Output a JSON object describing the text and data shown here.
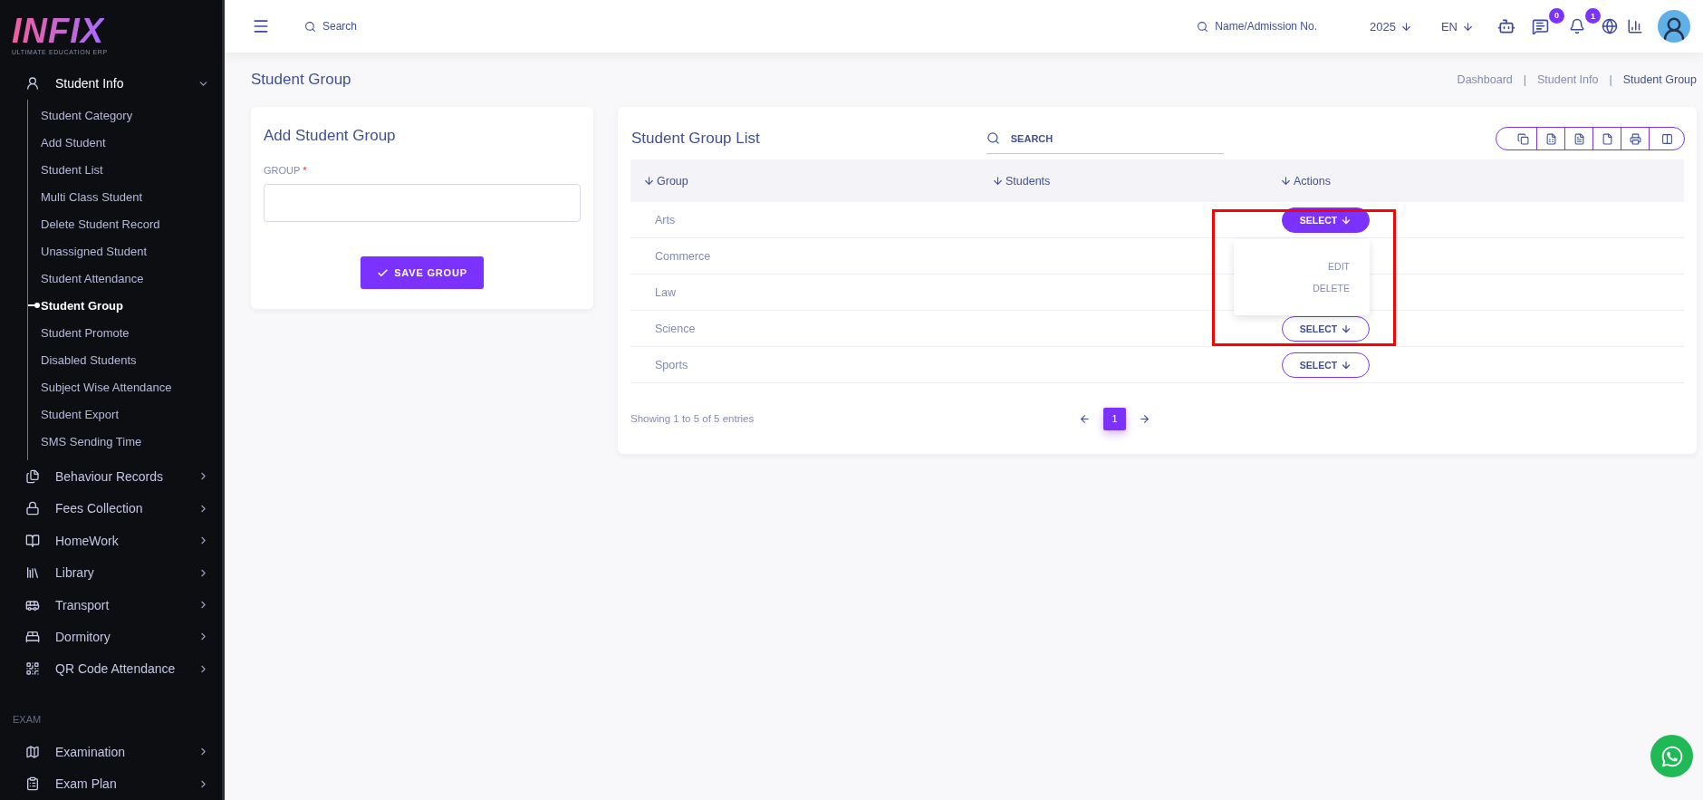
{
  "logo": {
    "name": "INFIX",
    "tagline": "ULTIMATE EDUCATION ERP"
  },
  "sidebar": {
    "sections": [
      {
        "label": "Student Info",
        "expanded": true,
        "children": [
          {
            "label": "Student Category",
            "selected": false
          },
          {
            "label": "Add Student",
            "selected": false
          },
          {
            "label": "Student List",
            "selected": false
          },
          {
            "label": "Multi Class Student",
            "selected": false
          },
          {
            "label": "Delete Student Record",
            "selected": false
          },
          {
            "label": "Unassigned Student",
            "selected": false
          },
          {
            "label": "Student Attendance",
            "selected": false
          },
          {
            "label": "Student Group",
            "selected": true
          },
          {
            "label": "Student Promote",
            "selected": false
          },
          {
            "label": "Disabled Students",
            "selected": false
          },
          {
            "label": "Subject Wise Attendance",
            "selected": false
          },
          {
            "label": "Student Export",
            "selected": false
          },
          {
            "label": "SMS Sending Time",
            "selected": false
          }
        ]
      },
      {
        "label": "Behaviour Records",
        "expanded": false
      },
      {
        "label": "Fees Collection",
        "expanded": false
      },
      {
        "label": "HomeWork",
        "expanded": false
      },
      {
        "label": "Library",
        "expanded": false
      },
      {
        "label": "Transport",
        "expanded": false
      },
      {
        "label": "Dormitory",
        "expanded": false
      },
      {
        "label": "QR Code Attendance",
        "expanded": false
      }
    ],
    "group_heading": "EXAM",
    "group_items": [
      {
        "label": "Examination",
        "expanded": false
      },
      {
        "label": "Exam Plan",
        "expanded": false
      }
    ]
  },
  "header": {
    "search": {
      "placeholder": "Search"
    },
    "student_search": {
      "placeholder": "Name/Admission No."
    },
    "year": "2025",
    "language": "EN",
    "messages_badge": "0",
    "notifications_badge": "1"
  },
  "page": {
    "title": "Student Group",
    "breadcrumb": [
      "Dashboard",
      "Student Info",
      "Student Group"
    ],
    "breadcrumb_separators": [
      "|",
      "|"
    ]
  },
  "form": {
    "title": "Add Student Group",
    "field_label": "GROUP",
    "required_mark": "*",
    "button": "SAVE GROUP"
  },
  "list": {
    "title": "Student Group List",
    "search": {
      "placeholder": "SEARCH"
    },
    "columns": [
      "Group",
      "Students",
      "Actions"
    ],
    "rows": [
      {
        "group": "Arts",
        "action": "SELECT",
        "open": true
      },
      {
        "group": "Commerce",
        "open": false
      },
      {
        "group": "Law",
        "open": false
      },
      {
        "group": "Science",
        "action": "SELECT",
        "open": false
      },
      {
        "group": "Sports",
        "action": "SELECT",
        "open": false
      }
    ],
    "menu": [
      "EDIT",
      "DELETE"
    ],
    "summary": "Showing 1 to 5 of 5 entries",
    "pages": [
      {
        "label": "1",
        "selected": true
      }
    ]
  }
}
